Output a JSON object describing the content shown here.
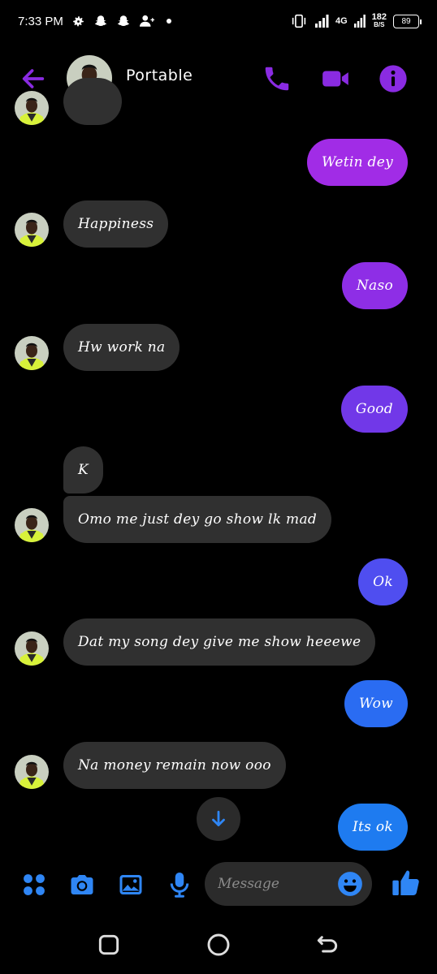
{
  "status_bar": {
    "time": "7:33 PM",
    "network": "4G",
    "net_speed_value": "182",
    "net_speed_unit": "B/S",
    "battery": "89",
    "icons": [
      "gear-icon",
      "snapchat-icon",
      "snapchat-icon",
      "add-contact-icon",
      "dot-icon",
      "vibrate-icon",
      "signal-icon",
      "signal-icon"
    ]
  },
  "header": {
    "contact_name": "Portable",
    "icons": [
      "back-arrow-icon",
      "phone-icon",
      "video-icon",
      "info-icon"
    ]
  },
  "messages": [
    {
      "direction": "out",
      "text": "Wetin dey"
    },
    {
      "direction": "in",
      "text": "Happiness"
    },
    {
      "direction": "out",
      "text": "Naso"
    },
    {
      "direction": "in",
      "text": "Hw work na"
    },
    {
      "direction": "out",
      "text": "Good"
    },
    {
      "direction": "in",
      "text": "K"
    },
    {
      "direction": "in",
      "text": "Omo me just dey go show lk mad"
    },
    {
      "direction": "out",
      "text": "Ok"
    },
    {
      "direction": "in",
      "text": "Dat my song dey give me show heeewe"
    },
    {
      "direction": "out",
      "text": "Wow"
    },
    {
      "direction": "in",
      "text": "Na money remain now ooo"
    },
    {
      "direction": "out",
      "text": "Its ok"
    }
  ],
  "composer": {
    "placeholder": "Message",
    "icons": [
      "apps-icon",
      "camera-icon",
      "gallery-icon",
      "microphone-icon",
      "emoji-icon",
      "thumbs-up-icon"
    ]
  },
  "nav_bar": {
    "icons": [
      "recents-icon",
      "home-icon",
      "back-icon"
    ]
  },
  "colors": {
    "accent": "#8a2be2",
    "incoming_bubble": "#303030",
    "outgoing_purple": "#9b2de0",
    "outgoing_blue": "#1e7bf0",
    "composer_icons": "#2f86f5"
  }
}
